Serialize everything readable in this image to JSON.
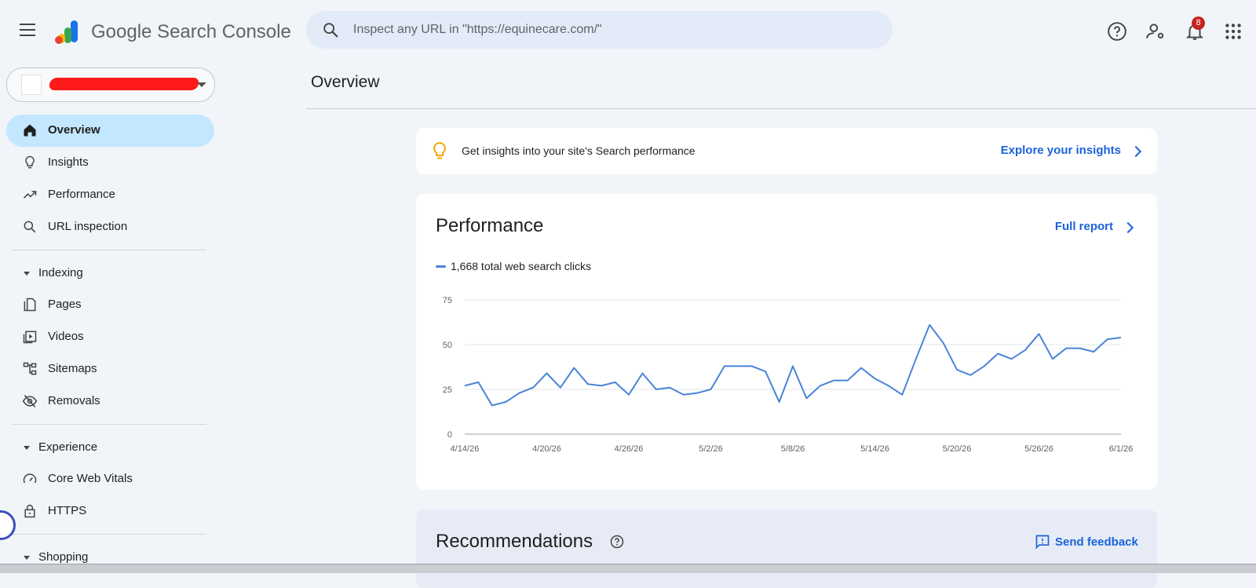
{
  "topbar": {
    "app_name": "Google Search Console",
    "search_placeholder": "Inspect any URL in \"https://equinecare.com/\"",
    "notification_count": "8",
    "icons": [
      "menu-icon",
      "search-icon",
      "help-icon",
      "manage-users-icon",
      "bell-icon",
      "apps-grid-icon"
    ]
  },
  "property": {
    "selector_icon": "favicon-icon"
  },
  "sidebar": {
    "items": [
      {
        "label": "Overview",
        "icon": "home-icon",
        "active": true
      },
      {
        "label": "Insights",
        "icon": "lightbulb-icon"
      },
      {
        "label": "Performance",
        "icon": "trending-up-icon"
      },
      {
        "label": "URL inspection",
        "icon": "search-icon"
      }
    ],
    "indexing": {
      "label": "Indexing",
      "items": [
        {
          "label": "Pages",
          "icon": "pages-icon"
        },
        {
          "label": "Videos",
          "icon": "video-icon"
        },
        {
          "label": "Sitemaps",
          "icon": "sitemap-icon"
        },
        {
          "label": "Removals",
          "icon": "eye-off-icon"
        }
      ]
    },
    "experience": {
      "label": "Experience",
      "items": [
        {
          "label": "Core Web Vitals",
          "icon": "speed-icon"
        },
        {
          "label": "HTTPS",
          "icon": "lock-icon"
        }
      ]
    },
    "shopping": {
      "label": "Shopping"
    }
  },
  "main": {
    "page_title": "Overview",
    "insights_banner": {
      "text": "Get insights into your site's Search performance",
      "link": "Explore your insights"
    },
    "performance": {
      "title": "Performance",
      "link": "Full report",
      "legend": "1,668 total web search clicks"
    },
    "recommendations": {
      "title": "Recommendations",
      "feedback": "Send feedback"
    }
  },
  "colors": {
    "accent": "#1a63d9",
    "line": "#4a84d9",
    "active_nav": "#c2e7ff",
    "badge": "#c5221f"
  },
  "chart_data": {
    "type": "line",
    "title": "",
    "xlabel": "",
    "ylabel": "",
    "ylim": [
      0,
      75
    ],
    "yticks": [
      0,
      25,
      50,
      75
    ],
    "grid": true,
    "xtick_labels": [
      "4/14/26",
      "4/20/26",
      "4/26/26",
      "5/2/26",
      "5/8/26",
      "5/14/26",
      "5/20/26",
      "5/26/26",
      "6/1/26"
    ],
    "series": [
      {
        "name": "1,668 total web search clicks",
        "x": [
          "4/14/26",
          "4/15/26",
          "4/16/26",
          "4/17/26",
          "4/18/26",
          "4/19/26",
          "4/20/26",
          "4/21/26",
          "4/22/26",
          "4/23/26",
          "4/24/26",
          "4/25/26",
          "4/26/26",
          "4/27/26",
          "4/28/26",
          "4/29/26",
          "4/30/26",
          "5/1/26",
          "5/2/26",
          "5/3/26",
          "5/4/26",
          "5/5/26",
          "5/6/26",
          "5/7/26",
          "5/8/26",
          "5/9/26",
          "5/10/26",
          "5/11/26",
          "5/12/26",
          "5/13/26",
          "5/14/26",
          "5/15/26",
          "5/16/26",
          "5/17/26",
          "5/18/26",
          "5/19/26",
          "5/20/26",
          "5/21/26",
          "5/22/26",
          "5/23/26",
          "5/24/26",
          "5/25/26",
          "5/26/26",
          "5/27/26",
          "5/28/26",
          "5/29/26",
          "5/30/26",
          "5/31/26",
          "6/1/26"
        ],
        "values": [
          27,
          29,
          16,
          18,
          23,
          26,
          34,
          26,
          37,
          28,
          27,
          29,
          22,
          34,
          25,
          26,
          22,
          23,
          25,
          38,
          38,
          38,
          35,
          18,
          38,
          20,
          27,
          30,
          30,
          37,
          31,
          27,
          22,
          42,
          61,
          51,
          36,
          33,
          38,
          45,
          42,
          47,
          56,
          42,
          48,
          48,
          46,
          53,
          54
        ]
      }
    ]
  }
}
